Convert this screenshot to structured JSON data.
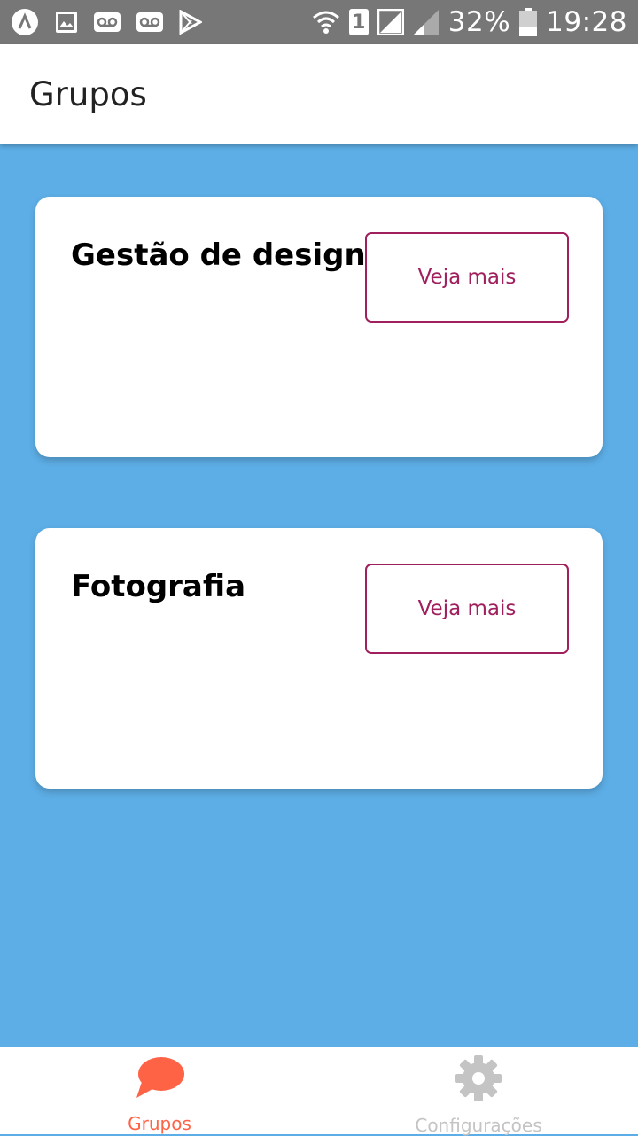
{
  "status_bar": {
    "battery_percent": "32%",
    "time": "19:28",
    "sim_slot": "1",
    "icons": [
      "app-icon",
      "image-icon",
      "voicemail-icon",
      "voicemail-icon",
      "play-store-icon",
      "wifi-icon",
      "sim-icon",
      "signal-icon",
      "signal-icon",
      "battery-icon"
    ]
  },
  "header": {
    "title": "Grupos"
  },
  "groups": [
    {
      "title": "Gestão de design",
      "button_label": "Veja mais"
    },
    {
      "title": "Fotografia",
      "button_label": "Veja mais"
    }
  ],
  "bottom_nav": {
    "items": [
      {
        "label": "Grupos",
        "icon": "chat-bubble-icon",
        "active": true
      },
      {
        "label": "Configurações",
        "icon": "gear-icon",
        "active": false
      }
    ]
  },
  "colors": {
    "background": "#5daee6",
    "accent": "#ff6346",
    "button_border": "#a0205e",
    "inactive": "#c4c4c4",
    "status_bar": "#777777"
  }
}
